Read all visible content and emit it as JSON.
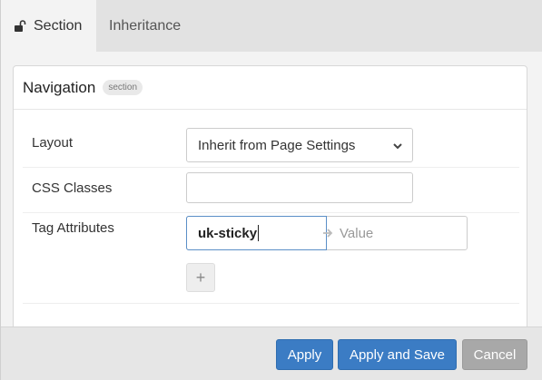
{
  "tabs": [
    {
      "label": "Section",
      "active": true
    },
    {
      "label": "Inheritance",
      "active": false
    }
  ],
  "panel": {
    "title": "Navigation",
    "badge": "section"
  },
  "fields": {
    "layout": {
      "label": "Layout",
      "value": "Inherit from Page Settings"
    },
    "css_classes": {
      "label": "CSS Classes",
      "value": ""
    },
    "tag_attributes": {
      "label": "Tag Attributes",
      "key": "uk-sticky",
      "value_placeholder": "Value"
    }
  },
  "footer": {
    "apply": "Apply",
    "apply_save": "Apply and Save",
    "cancel": "Cancel"
  },
  "colors": {
    "primary": "#3b7cc4",
    "cancel": "#a8a8a8"
  }
}
